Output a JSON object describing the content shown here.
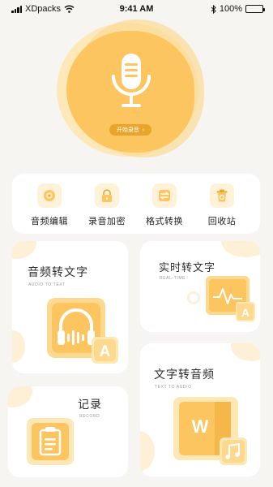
{
  "status_bar": {
    "carrier": "XDpacks",
    "time": "9:41 AM",
    "battery": "100%",
    "battery_level": 1.0
  },
  "hero": {
    "start_label": "开始录音",
    "start_arrow": "›"
  },
  "tools": [
    {
      "label": "音频编辑",
      "icon": "audio-edit-icon"
    },
    {
      "label": "录音加密",
      "icon": "lock-icon"
    },
    {
      "label": "格式转换",
      "icon": "convert-icon"
    },
    {
      "label": "回收站",
      "icon": "recycle-bin-icon"
    }
  ],
  "cards": {
    "audio_to_text": {
      "title": "音频转文字",
      "subtitle": "AUDIO TO TEXT",
      "icon_letter": "A"
    },
    "realtime": {
      "title": "实时转文字",
      "subtitle": "REAL-TIME",
      "icon_letter": "A"
    },
    "text_to_audio": {
      "title": "文字转音频",
      "subtitle": "TEXT TO AUDIO",
      "icon_letter": "W"
    },
    "record": {
      "title": "记录",
      "subtitle": "RECORD"
    }
  },
  "colors": {
    "accent": "#fcc560",
    "accent_dark": "#e8a52a",
    "accent_light": "#fff2d8",
    "background": "#f7f5f2"
  }
}
